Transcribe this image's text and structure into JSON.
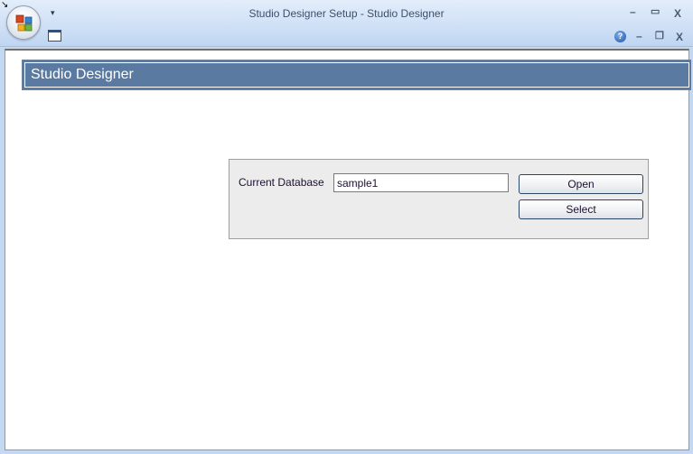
{
  "window": {
    "title": "Studio Designer Setup - Studio Designer",
    "controls": {
      "minimize": "–",
      "maximize": "▭",
      "close": "X"
    },
    "inner_controls": {
      "help": "?",
      "minimize": "–",
      "restore": "❐",
      "close": "X"
    },
    "qat_arrow": "▾",
    "corner_arrow": "↘"
  },
  "header": {
    "title": "Studio Designer"
  },
  "database_panel": {
    "label": "Current Database",
    "value": "sample1",
    "open_label": "Open",
    "select_label": "Select"
  }
}
